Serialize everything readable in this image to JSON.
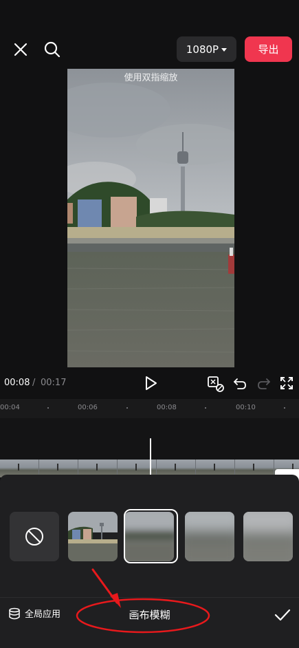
{
  "header": {
    "resolution_label": "1080P",
    "export_label": "导出"
  },
  "preview": {
    "pinch_hint": "使用双指缩放"
  },
  "playback": {
    "current_time": "00:08",
    "separator": "/",
    "total_time": "00:17"
  },
  "ruler": {
    "ticks": [
      "00:04",
      "00:06",
      "00:08",
      "00:10"
    ]
  },
  "panel": {
    "apply_all_label": "全局应用",
    "title": "画布模糊",
    "options": [
      "none",
      "image-background",
      "blur-light",
      "blur-medium",
      "blur-heavy"
    ],
    "selected_option": "blur-light"
  },
  "colors": {
    "accent_export": "#f0364f",
    "annotation_red": "#e8191c",
    "background": "#111112",
    "panel_bg": "#1f1f21"
  }
}
